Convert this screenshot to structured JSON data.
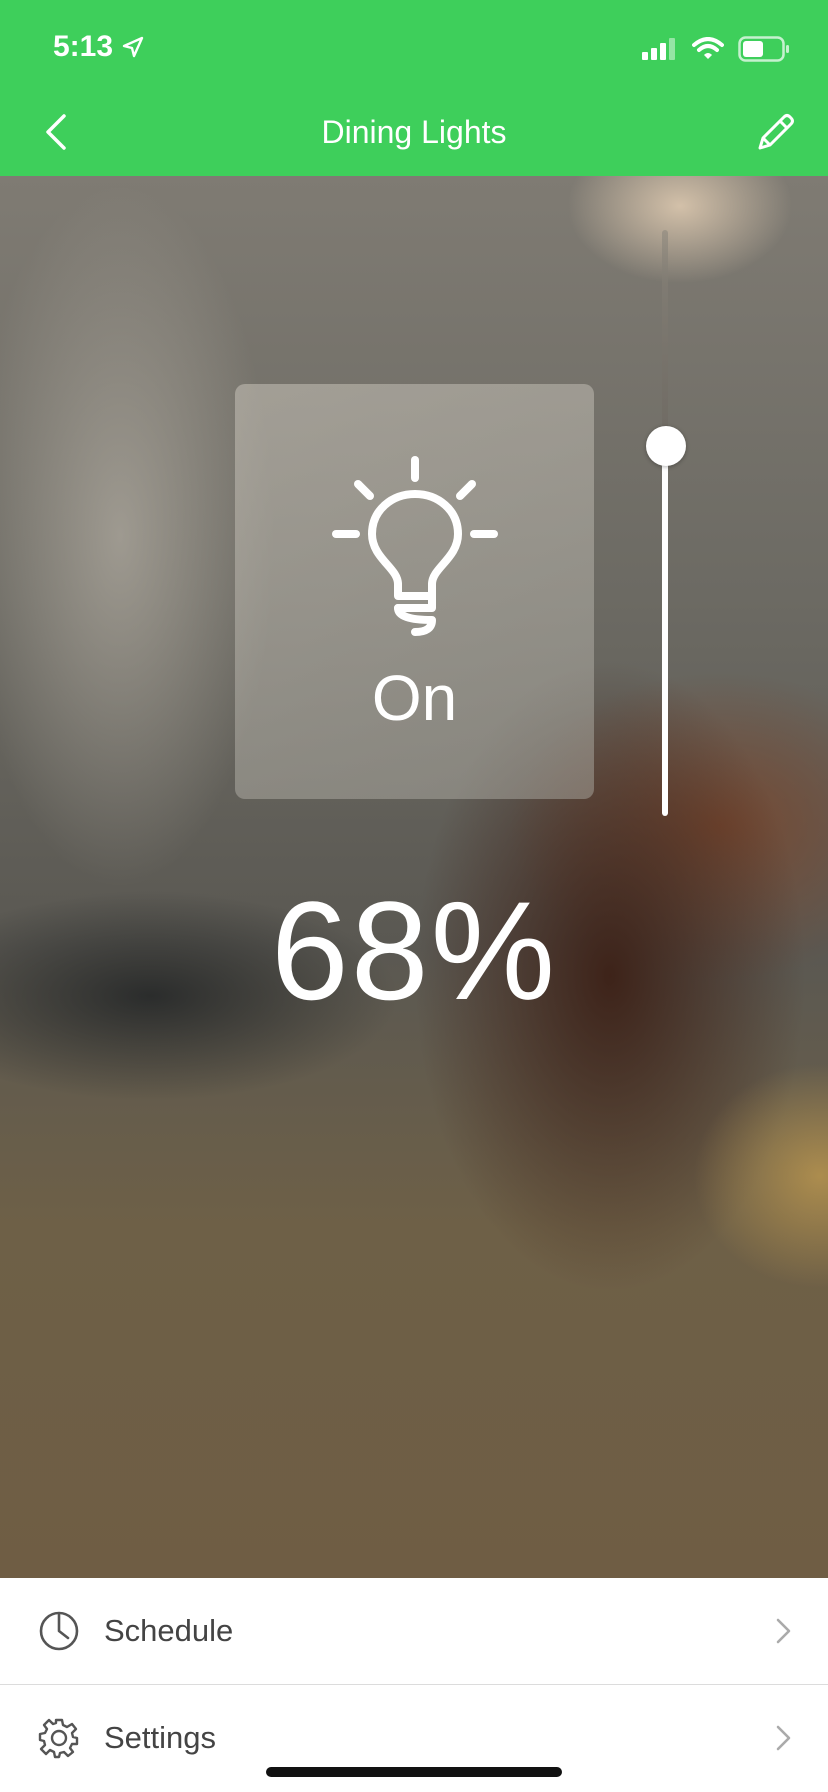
{
  "status_bar": {
    "time": "5:13"
  },
  "nav": {
    "title": "Dining Lights"
  },
  "light": {
    "state": "On",
    "brightness_label": "68%",
    "brightness_level": 0.68
  },
  "menu": {
    "items": [
      {
        "label": "Schedule",
        "icon": "clock-icon"
      },
      {
        "label": "Settings",
        "icon": "gear-icon"
      }
    ]
  },
  "colors": {
    "accent": "#3ecf5b"
  }
}
